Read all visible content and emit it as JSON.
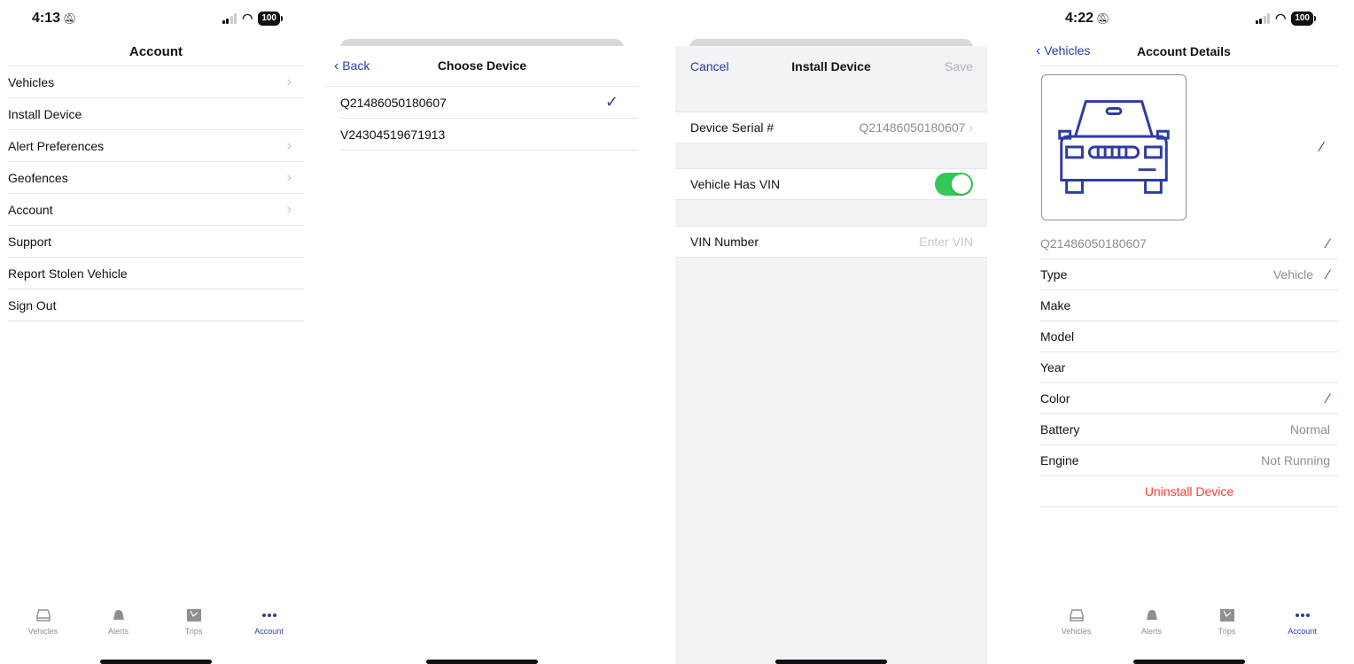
{
  "screen1": {
    "time": "4:13",
    "battery": "100",
    "title": "Account",
    "items": [
      {
        "label": "Vehicles",
        "chevron": true
      },
      {
        "label": "Install Device",
        "chevron": false
      },
      {
        "label": "Alert Preferences",
        "chevron": true
      },
      {
        "label": "Geofences",
        "chevron": true
      },
      {
        "label": "Account",
        "chevron": true
      },
      {
        "label": "Support",
        "chevron": false
      },
      {
        "label": "Report Stolen Vehicle",
        "chevron": false
      },
      {
        "label": "Sign Out",
        "chevron": false
      }
    ]
  },
  "screen2": {
    "back": "Back",
    "title": "Choose Device",
    "devices": [
      {
        "serial": "Q21486050180607",
        "selected": true
      },
      {
        "serial": "V24304519671913",
        "selected": false
      }
    ]
  },
  "screen3": {
    "cancel": "Cancel",
    "title": "Install Device",
    "save": "Save",
    "serial_label": "Device Serial #",
    "serial_value": "Q21486050180607",
    "vin_toggle_label": "Vehicle Has VIN",
    "vin_toggle_on": true,
    "vin_label": "VIN Number",
    "vin_placeholder": "Enter VIN"
  },
  "screen4": {
    "time": "4:22",
    "battery": "100",
    "back": "Vehicles",
    "title": "Account Details",
    "serial": "Q21486050180607",
    "rows": [
      {
        "label": "Type",
        "value": "Vehicle",
        "editable": true
      },
      {
        "label": "Make",
        "value": "",
        "editable": false
      },
      {
        "label": "Model",
        "value": "",
        "editable": false
      },
      {
        "label": "Year",
        "value": "",
        "editable": false
      },
      {
        "label": "Color",
        "value": "",
        "editable": true
      },
      {
        "label": "Battery",
        "value": "Normal",
        "editable": false
      },
      {
        "label": "Engine",
        "value": "Not Running",
        "editable": false
      }
    ],
    "uninstall": "Uninstall Device"
  },
  "tabbar": {
    "tabs": [
      {
        "label": "Vehicles",
        "icon": "car-icon"
      },
      {
        "label": "Alerts",
        "icon": "bell-icon"
      },
      {
        "label": "Trips",
        "icon": "map-icon"
      },
      {
        "label": "Account",
        "icon": "more-icon"
      }
    ],
    "active": "Account"
  },
  "colors": {
    "accent": "#2e3ba6",
    "destructive": "#ff3b30",
    "toggle_on": "#34c759"
  }
}
